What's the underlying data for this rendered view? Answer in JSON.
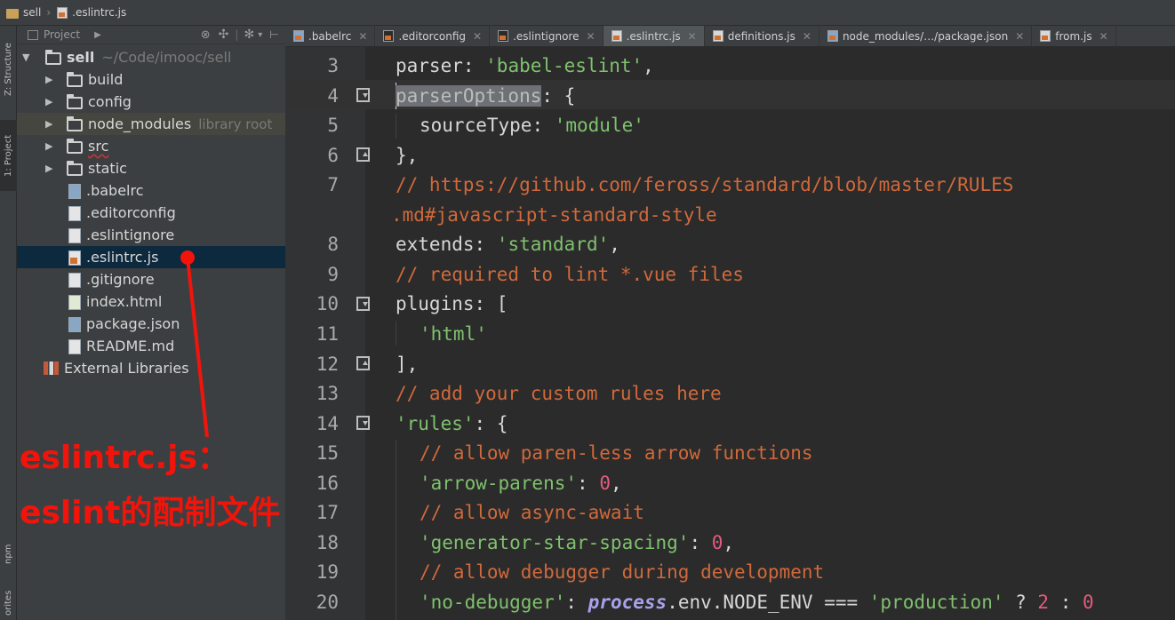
{
  "breadcrumb": [
    "sell",
    ".eslintrc.js"
  ],
  "strip": {
    "structure": "Z: Structure",
    "project": "1: Project",
    "npm": "npm",
    "favorites": "orites"
  },
  "project_panel": {
    "title": "Project",
    "root": {
      "name": "sell",
      "path": "~/Code/imooc/sell"
    },
    "items": [
      {
        "name": "build",
        "type": "folder"
      },
      {
        "name": "config",
        "type": "folder"
      },
      {
        "name": "node_modules",
        "type": "folder",
        "note": "library root"
      },
      {
        "name": "src",
        "type": "folder"
      },
      {
        "name": "static",
        "type": "folder"
      },
      {
        "name": ".babelrc",
        "type": "file"
      },
      {
        "name": ".editorconfig",
        "type": "file"
      },
      {
        "name": ".eslintignore",
        "type": "file"
      },
      {
        "name": ".eslintrc.js",
        "type": "js"
      },
      {
        "name": ".gitignore",
        "type": "file"
      },
      {
        "name": "index.html",
        "type": "html"
      },
      {
        "name": "package.json",
        "type": "json"
      },
      {
        "name": "README.md",
        "type": "file"
      }
    ],
    "external": "External Libraries"
  },
  "tabs": [
    {
      "label": ".babelrc",
      "active": false
    },
    {
      "label": ".editorconfig",
      "active": false
    },
    {
      "label": ".eslintignore",
      "active": false
    },
    {
      "label": ".eslintrc.js",
      "active": true
    },
    {
      "label": "definitions.js",
      "active": false
    },
    {
      "label": "node_modules/…/package.json",
      "active": false
    },
    {
      "label": "from.js",
      "active": false
    }
  ],
  "line_numbers": [
    "3",
    "4",
    "5",
    "6",
    "7",
    "8",
    "9",
    "10",
    "11",
    "12",
    "13",
    "14",
    "15",
    "16",
    "17",
    "18",
    "19",
    "20"
  ],
  "code": {
    "l3": [
      "parser",
      ": ",
      "'babel-eslint'",
      ","
    ],
    "l4": [
      "parserOptions",
      ": {"
    ],
    "l5": [
      "sourceType",
      ": ",
      "'module'"
    ],
    "l6": "},",
    "l7a": "// https://github.com/feross/standard/blob/master/RULES",
    "l7b": ".md#javascript-standard-style",
    "l8": [
      "extends",
      ": ",
      "'standard'",
      ","
    ],
    "l9": "// required to lint *.vue files",
    "l10": [
      "plugins",
      ": ["
    ],
    "l11": "'html'",
    "l12": "],",
    "l13": "// add your custom rules here",
    "l14": [
      "'rules'",
      ": {"
    ],
    "l15": "// allow paren-less arrow functions",
    "l16": [
      "'arrow-parens'",
      ": ",
      "0",
      ","
    ],
    "l17": "// allow async-await",
    "l18": [
      "'generator-star-spacing'",
      ": ",
      "0",
      ","
    ],
    "l19": "// allow debugger during development",
    "l20": [
      "'no-debugger'",
      ": ",
      "process",
      ".env.NODE_ENV === ",
      "'production'",
      " ? ",
      "2",
      " : ",
      "0"
    ]
  },
  "annotation": {
    "line1": "eslintrc.js：",
    "line2": "eslint的配制文件"
  },
  "colors": {
    "string": "#7fc16e",
    "comment": "#d0693b",
    "number": "#e35b7e",
    "annotation": "#f2140a",
    "selection": "#0d293e"
  }
}
